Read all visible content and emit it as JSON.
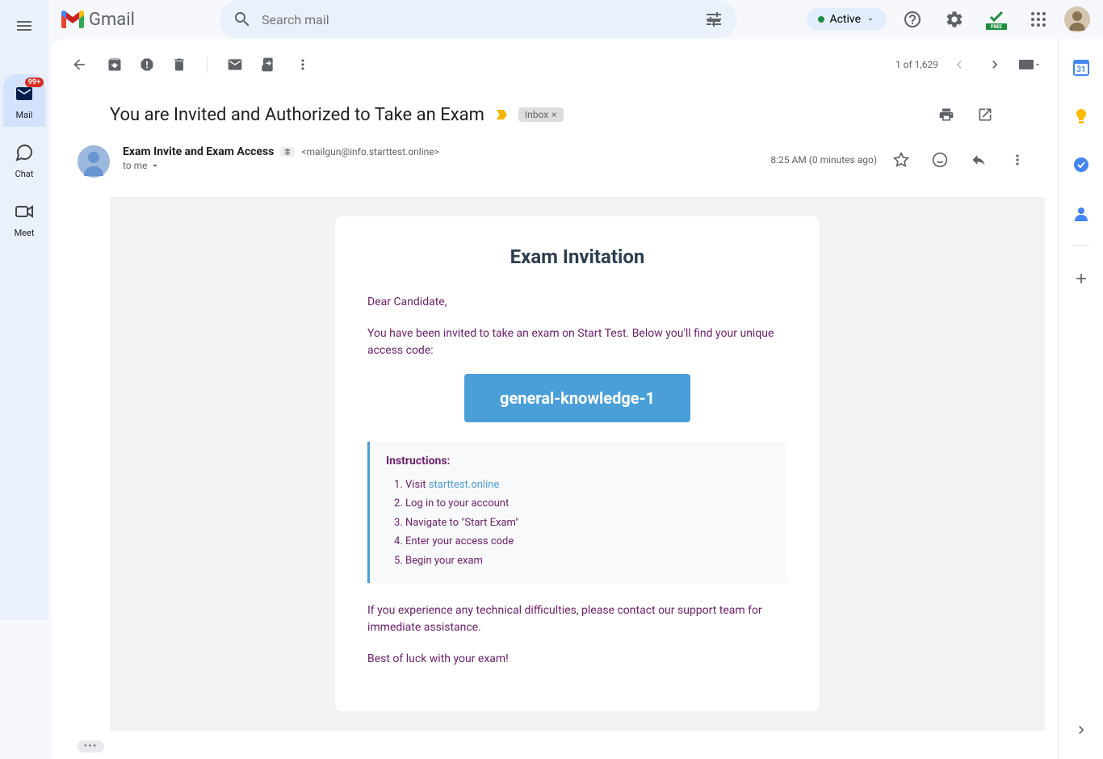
{
  "header": {
    "logo_text": "Gmail",
    "search_placeholder": "Search mail",
    "active_label": "Active"
  },
  "nav": {
    "mail": {
      "label": "Mail",
      "badge": "99+"
    },
    "chat": {
      "label": "Chat"
    },
    "meet": {
      "label": "Meet"
    }
  },
  "toolbar": {
    "position": "1 of 1,629"
  },
  "email": {
    "subject": "You are Invited and Authorized to Take an Exam",
    "inbox_label": "Inbox",
    "sender_name": "Exam Invite and Exam Access",
    "sender_email": "<mailgun@info.starttest.online>",
    "to_label": "to me",
    "timestamp": "8:25 AM (0 minutes ago)"
  },
  "body": {
    "title": "Exam Invitation",
    "greeting": "Dear Candidate,",
    "intro": "You have been invited to take an exam on Start Test. Below you'll find your unique access code:",
    "access_code": "general-knowledge-1",
    "instructions_title": "Instructions:",
    "steps": {
      "s1_prefix": "Visit ",
      "s1_link": "starttest.online",
      "s2": "Log in to your account",
      "s3": "Navigate to \"Start Exam\"",
      "s4": "Enter your access code",
      "s5": "Begin your exam"
    },
    "support": "If you experience any technical difficulties, please contact our support team for immediate assistance.",
    "closing": "Best of luck with your exam!"
  }
}
